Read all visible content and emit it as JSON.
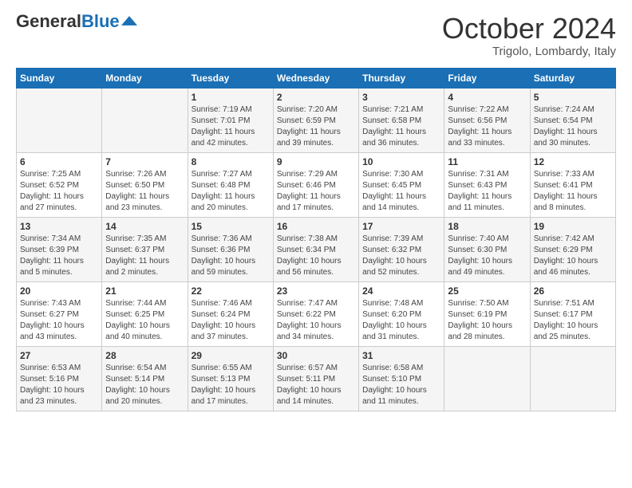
{
  "header": {
    "logo_general": "General",
    "logo_blue": "Blue",
    "month": "October 2024",
    "location": "Trigolo, Lombardy, Italy"
  },
  "days_of_week": [
    "Sunday",
    "Monday",
    "Tuesday",
    "Wednesday",
    "Thursday",
    "Friday",
    "Saturday"
  ],
  "weeks": [
    [
      {
        "day": "",
        "info": ""
      },
      {
        "day": "",
        "info": ""
      },
      {
        "day": "1",
        "info": "Sunrise: 7:19 AM\nSunset: 7:01 PM\nDaylight: 11 hours and 42 minutes."
      },
      {
        "day": "2",
        "info": "Sunrise: 7:20 AM\nSunset: 6:59 PM\nDaylight: 11 hours and 39 minutes."
      },
      {
        "day": "3",
        "info": "Sunrise: 7:21 AM\nSunset: 6:58 PM\nDaylight: 11 hours and 36 minutes."
      },
      {
        "day": "4",
        "info": "Sunrise: 7:22 AM\nSunset: 6:56 PM\nDaylight: 11 hours and 33 minutes."
      },
      {
        "day": "5",
        "info": "Sunrise: 7:24 AM\nSunset: 6:54 PM\nDaylight: 11 hours and 30 minutes."
      }
    ],
    [
      {
        "day": "6",
        "info": "Sunrise: 7:25 AM\nSunset: 6:52 PM\nDaylight: 11 hours and 27 minutes."
      },
      {
        "day": "7",
        "info": "Sunrise: 7:26 AM\nSunset: 6:50 PM\nDaylight: 11 hours and 23 minutes."
      },
      {
        "day": "8",
        "info": "Sunrise: 7:27 AM\nSunset: 6:48 PM\nDaylight: 11 hours and 20 minutes."
      },
      {
        "day": "9",
        "info": "Sunrise: 7:29 AM\nSunset: 6:46 PM\nDaylight: 11 hours and 17 minutes."
      },
      {
        "day": "10",
        "info": "Sunrise: 7:30 AM\nSunset: 6:45 PM\nDaylight: 11 hours and 14 minutes."
      },
      {
        "day": "11",
        "info": "Sunrise: 7:31 AM\nSunset: 6:43 PM\nDaylight: 11 hours and 11 minutes."
      },
      {
        "day": "12",
        "info": "Sunrise: 7:33 AM\nSunset: 6:41 PM\nDaylight: 11 hours and 8 minutes."
      }
    ],
    [
      {
        "day": "13",
        "info": "Sunrise: 7:34 AM\nSunset: 6:39 PM\nDaylight: 11 hours and 5 minutes."
      },
      {
        "day": "14",
        "info": "Sunrise: 7:35 AM\nSunset: 6:37 PM\nDaylight: 11 hours and 2 minutes."
      },
      {
        "day": "15",
        "info": "Sunrise: 7:36 AM\nSunset: 6:36 PM\nDaylight: 10 hours and 59 minutes."
      },
      {
        "day": "16",
        "info": "Sunrise: 7:38 AM\nSunset: 6:34 PM\nDaylight: 10 hours and 56 minutes."
      },
      {
        "day": "17",
        "info": "Sunrise: 7:39 AM\nSunset: 6:32 PM\nDaylight: 10 hours and 52 minutes."
      },
      {
        "day": "18",
        "info": "Sunrise: 7:40 AM\nSunset: 6:30 PM\nDaylight: 10 hours and 49 minutes."
      },
      {
        "day": "19",
        "info": "Sunrise: 7:42 AM\nSunset: 6:29 PM\nDaylight: 10 hours and 46 minutes."
      }
    ],
    [
      {
        "day": "20",
        "info": "Sunrise: 7:43 AM\nSunset: 6:27 PM\nDaylight: 10 hours and 43 minutes."
      },
      {
        "day": "21",
        "info": "Sunrise: 7:44 AM\nSunset: 6:25 PM\nDaylight: 10 hours and 40 minutes."
      },
      {
        "day": "22",
        "info": "Sunrise: 7:46 AM\nSunset: 6:24 PM\nDaylight: 10 hours and 37 minutes."
      },
      {
        "day": "23",
        "info": "Sunrise: 7:47 AM\nSunset: 6:22 PM\nDaylight: 10 hours and 34 minutes."
      },
      {
        "day": "24",
        "info": "Sunrise: 7:48 AM\nSunset: 6:20 PM\nDaylight: 10 hours and 31 minutes."
      },
      {
        "day": "25",
        "info": "Sunrise: 7:50 AM\nSunset: 6:19 PM\nDaylight: 10 hours and 28 minutes."
      },
      {
        "day": "26",
        "info": "Sunrise: 7:51 AM\nSunset: 6:17 PM\nDaylight: 10 hours and 25 minutes."
      }
    ],
    [
      {
        "day": "27",
        "info": "Sunrise: 6:53 AM\nSunset: 5:16 PM\nDaylight: 10 hours and 23 minutes."
      },
      {
        "day": "28",
        "info": "Sunrise: 6:54 AM\nSunset: 5:14 PM\nDaylight: 10 hours and 20 minutes."
      },
      {
        "day": "29",
        "info": "Sunrise: 6:55 AM\nSunset: 5:13 PM\nDaylight: 10 hours and 17 minutes."
      },
      {
        "day": "30",
        "info": "Sunrise: 6:57 AM\nSunset: 5:11 PM\nDaylight: 10 hours and 14 minutes."
      },
      {
        "day": "31",
        "info": "Sunrise: 6:58 AM\nSunset: 5:10 PM\nDaylight: 10 hours and 11 minutes."
      },
      {
        "day": "",
        "info": ""
      },
      {
        "day": "",
        "info": ""
      }
    ]
  ]
}
